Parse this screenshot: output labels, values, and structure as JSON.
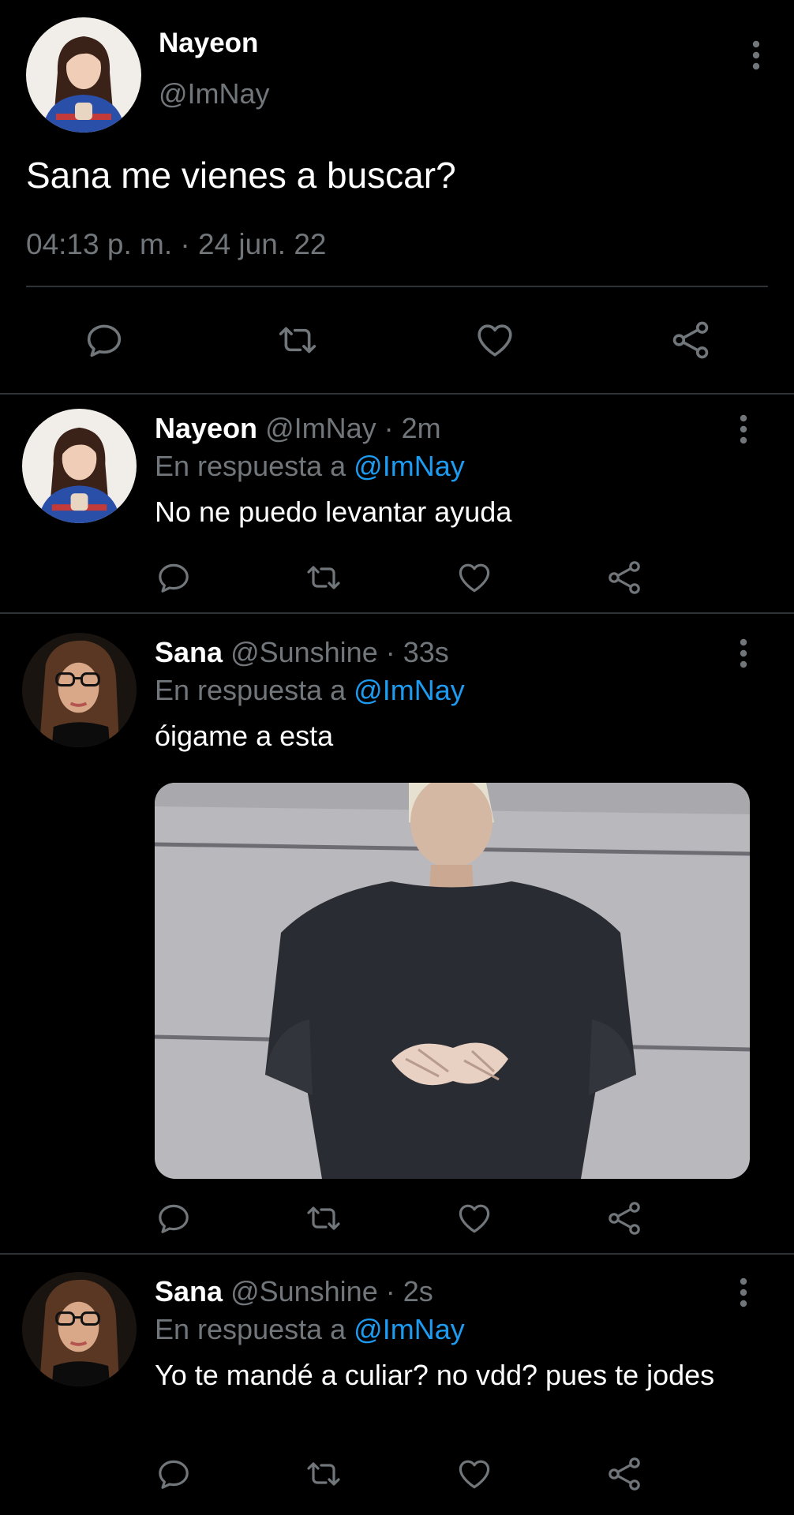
{
  "main_tweet": {
    "name": "Nayeon",
    "handle": "@ImNay",
    "text": "Sana me vienes a buscar?",
    "timestamp": "04:13 p. m. · 24 jun. 22",
    "avatar_icon": "profile-photo-nayeon",
    "actions": [
      "reply-icon",
      "retweet-icon",
      "like-icon",
      "share-icon"
    ]
  },
  "replies": [
    {
      "name": "Nayeon",
      "handle_time": "@ImNay · 2m",
      "in_reply_prefix": "En respuesta a",
      "in_reply_to": "@ImNay",
      "text": "No ne puedo levantar ayuda"
    },
    {
      "name": "Sana",
      "handle_time": "@Sunshine · 33s",
      "in_reply_prefix": "En respuesta a",
      "in_reply_to": "@ImNay",
      "text": "óigame a esta",
      "media": "photo-person-black-shirt-hands-on-belly"
    },
    {
      "name": "Sana",
      "handle_time": "@Sunshine · 2s",
      "in_reply_prefix": "En respuesta a",
      "in_reply_to": "@ImNay",
      "text": "Yo te mandé a culiar? no vdd? pues te jodes"
    }
  ],
  "colors": {
    "background": "#000000",
    "text": "#e7e9ea",
    "muted": "#71767b",
    "link": "#1d9bf0",
    "divider": "#2f3336"
  }
}
